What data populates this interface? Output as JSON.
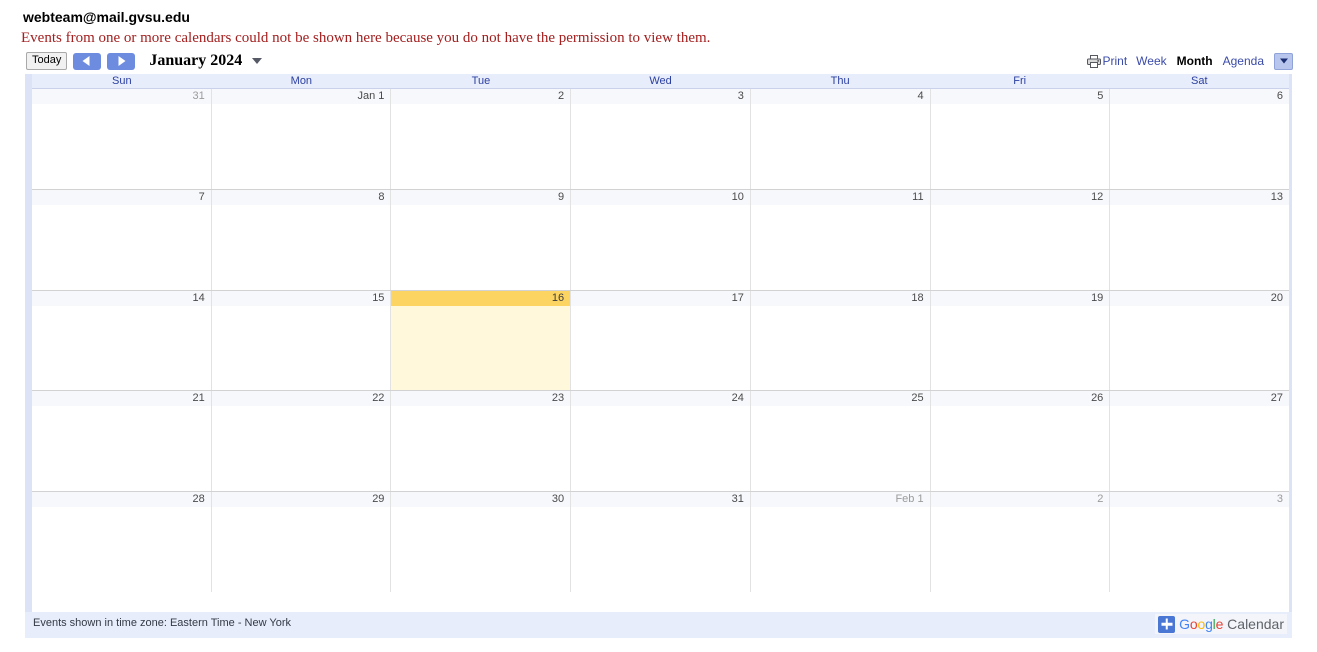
{
  "header": {
    "calendar_title": "webteam@mail.gvsu.edu",
    "permission_warning": "Events from one or more calendars could not be shown here because you do not have the permission to view them."
  },
  "nav": {
    "today_label": "Today",
    "prev_icon": "triangle-left-icon",
    "next_icon": "triangle-right-icon",
    "period_label": "January 2024",
    "caret_icon": "chevron-down-icon"
  },
  "views": {
    "print_label": "Print",
    "print_icon": "printer-icon",
    "items": [
      {
        "label": "Week",
        "active": false
      },
      {
        "label": "Month",
        "active": true
      },
      {
        "label": "Agenda",
        "active": false
      }
    ],
    "dropdown_icon": "chevron-down-icon"
  },
  "grid": {
    "day_headers": [
      "Sun",
      "Mon",
      "Tue",
      "Wed",
      "Thu",
      "Fri",
      "Sat"
    ],
    "weeks": [
      [
        {
          "label": "31",
          "other_month": true,
          "today": false
        },
        {
          "label": "Jan 1",
          "other_month": false,
          "today": false
        },
        {
          "label": "2",
          "other_month": false,
          "today": false
        },
        {
          "label": "3",
          "other_month": false,
          "today": false
        },
        {
          "label": "4",
          "other_month": false,
          "today": false
        },
        {
          "label": "5",
          "other_month": false,
          "today": false
        },
        {
          "label": "6",
          "other_month": false,
          "today": false
        }
      ],
      [
        {
          "label": "7",
          "other_month": false,
          "today": false
        },
        {
          "label": "8",
          "other_month": false,
          "today": false
        },
        {
          "label": "9",
          "other_month": false,
          "today": false
        },
        {
          "label": "10",
          "other_month": false,
          "today": false
        },
        {
          "label": "11",
          "other_month": false,
          "today": false
        },
        {
          "label": "12",
          "other_month": false,
          "today": false
        },
        {
          "label": "13",
          "other_month": false,
          "today": false
        }
      ],
      [
        {
          "label": "14",
          "other_month": false,
          "today": false
        },
        {
          "label": "15",
          "other_month": false,
          "today": false
        },
        {
          "label": "16",
          "other_month": false,
          "today": true
        },
        {
          "label": "17",
          "other_month": false,
          "today": false
        },
        {
          "label": "18",
          "other_month": false,
          "today": false
        },
        {
          "label": "19",
          "other_month": false,
          "today": false
        },
        {
          "label": "20",
          "other_month": false,
          "today": false
        }
      ],
      [
        {
          "label": "21",
          "other_month": false,
          "today": false
        },
        {
          "label": "22",
          "other_month": false,
          "today": false
        },
        {
          "label": "23",
          "other_month": false,
          "today": false
        },
        {
          "label": "24",
          "other_month": false,
          "today": false
        },
        {
          "label": "25",
          "other_month": false,
          "today": false
        },
        {
          "label": "26",
          "other_month": false,
          "today": false
        },
        {
          "label": "27",
          "other_month": false,
          "today": false
        }
      ],
      [
        {
          "label": "28",
          "other_month": false,
          "today": false
        },
        {
          "label": "29",
          "other_month": false,
          "today": false
        },
        {
          "label": "30",
          "other_month": false,
          "today": false
        },
        {
          "label": "31",
          "other_month": false,
          "today": false
        },
        {
          "label": "Feb 1",
          "other_month": true,
          "today": false
        },
        {
          "label": "2",
          "other_month": true,
          "today": false
        },
        {
          "label": "3",
          "other_month": true,
          "today": false
        }
      ]
    ]
  },
  "footer": {
    "timezone_note": "Events shown in time zone: Eastern Time - New York",
    "logo": {
      "plus_icon": "plus-icon",
      "g1": "G",
      "o1": "o",
      "o2": "o",
      "g2": "g",
      "l": "l",
      "e": "e",
      "calendar_word": "Calendar"
    }
  },
  "colors": {
    "today_header": "#fcd462",
    "today_body": "#fff8db",
    "header_band": "#e8edfb",
    "link_blue": "#3b4ba8",
    "warning_red": "#a32020"
  }
}
